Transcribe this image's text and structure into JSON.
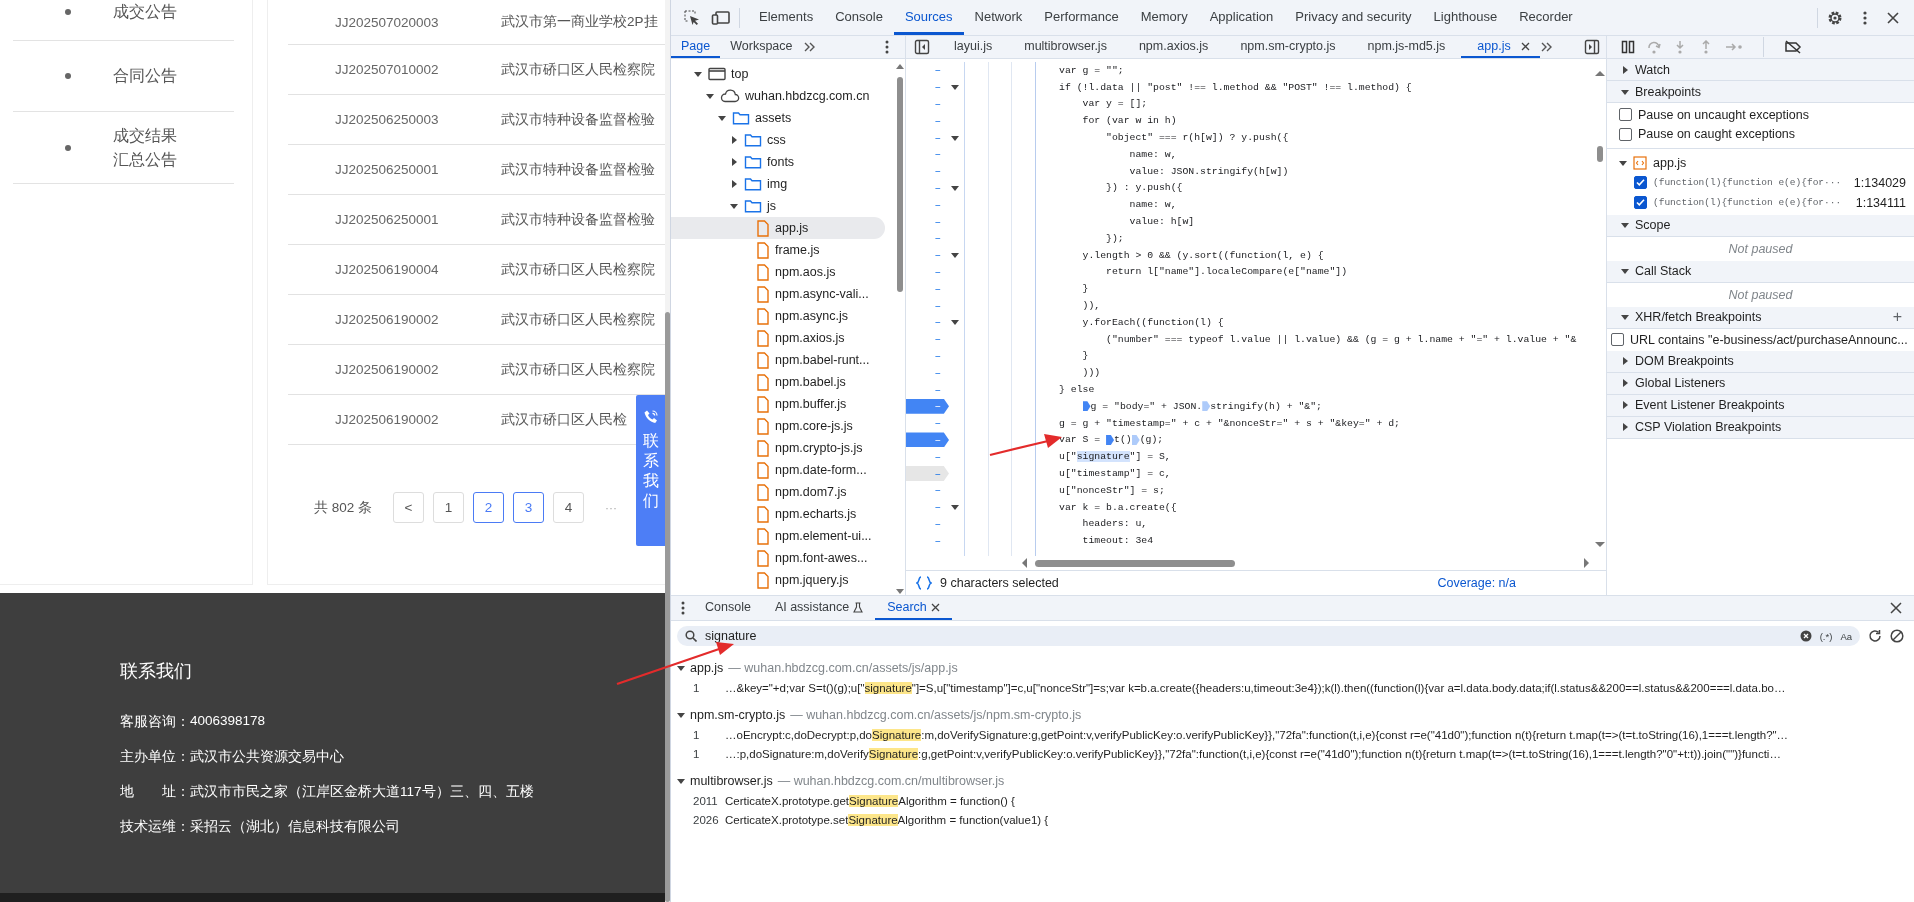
{
  "page": {
    "sidebar": {
      "items": [
        {
          "label": "成交公告"
        },
        {
          "label": "合同公告"
        },
        {
          "label": "成交结果汇总公告"
        }
      ]
    },
    "table": {
      "rows": [
        {
          "code": "JJ202507020003",
          "name": "武汉市第一商业学校2P挂"
        },
        {
          "code": "JJ202507010002",
          "name": "武汉市硚口区人民检察院"
        },
        {
          "code": "JJ202506250003",
          "name": "武汉市特种设备监督检验"
        },
        {
          "code": "JJ202506250001",
          "name": "武汉市特种设备监督检验"
        },
        {
          "code": "JJ202506250001",
          "name": "武汉市特种设备监督检验"
        },
        {
          "code": "JJ202506190004",
          "name": "武汉市硚口区人民检察院"
        },
        {
          "code": "JJ202506190002",
          "name": "武汉市硚口区人民检察院"
        },
        {
          "code": "JJ202506190002",
          "name": "武汉市硚口区人民检察院"
        },
        {
          "code": "JJ202506190002",
          "name": "武汉市硚口区人民检"
        }
      ]
    },
    "pagination": {
      "total": "共 802 条",
      "prev": "<",
      "pages": [
        {
          "label": "1",
          "highlighted": false
        },
        {
          "label": "2",
          "highlighted": true
        },
        {
          "label": "3",
          "highlighted": true
        },
        {
          "label": "4",
          "highlighted": false
        }
      ],
      "ellipsis": "···"
    },
    "contact_tab": {
      "label": "联系我们"
    },
    "footer": {
      "title": "联系我们",
      "lines": [
        {
          "label": "客服咨询：",
          "value": "4006398178"
        },
        {
          "label": "主办单位：",
          "value": "武汉市公共资源交易中心"
        },
        {
          "label": "地　　址：",
          "value": "武汉市市民之家（江岸区金桥大道117号）三、四、五楼"
        },
        {
          "label": "技术运维：",
          "value": "采招云（湖北）信息科技有限公司"
        }
      ]
    }
  },
  "devtools": {
    "panel_tabs": [
      {
        "label": "Elements",
        "selected": false
      },
      {
        "label": "Console",
        "selected": false
      },
      {
        "label": "Sources",
        "selected": true
      },
      {
        "label": "Network",
        "selected": false
      },
      {
        "label": "Performance",
        "selected": false
      },
      {
        "label": "Memory",
        "selected": false
      },
      {
        "label": "Application",
        "selected": false
      },
      {
        "label": "Privacy and security",
        "selected": false
      },
      {
        "label": "Lighthouse",
        "selected": false
      },
      {
        "label": "Recorder",
        "selected": false
      }
    ],
    "navigator": {
      "tabs": [
        {
          "label": "Page",
          "selected": true
        },
        {
          "label": "Workspace",
          "selected": false
        }
      ],
      "tree": [
        {
          "label": "top",
          "kind": "frame",
          "expanded": true,
          "selected": false,
          "children": [
            {
              "label": "wuhan.hbdzcg.com.cn",
              "kind": "domain",
              "expanded": true,
              "selected": false,
              "children": [
                {
                  "label": "assets",
                  "kind": "folder",
                  "expanded": true,
                  "selected": false,
                  "children": [
                    {
                      "label": "css",
                      "kind": "folder",
                      "expanded": false,
                      "selected": false
                    },
                    {
                      "label": "fonts",
                      "kind": "folder",
                      "expanded": false,
                      "selected": false
                    },
                    {
                      "label": "img",
                      "kind": "folder",
                      "expanded": false,
                      "selected": false
                    },
                    {
                      "label": "js",
                      "kind": "folder",
                      "expanded": true,
                      "selected": false,
                      "children": [
                        {
                          "label": "app.js",
                          "kind": "file",
                          "selected": true
                        },
                        {
                          "label": "frame.js",
                          "kind": "file",
                          "selected": false
                        },
                        {
                          "label": "npm.aos.js",
                          "kind": "file",
                          "selected": false
                        },
                        {
                          "label": "npm.async-vali...",
                          "kind": "file",
                          "selected": false
                        },
                        {
                          "label": "npm.async.js",
                          "kind": "file",
                          "selected": false
                        },
                        {
                          "label": "npm.axios.js",
                          "kind": "file",
                          "selected": false
                        },
                        {
                          "label": "npm.babel-runt...",
                          "kind": "file",
                          "selected": false
                        },
                        {
                          "label": "npm.babel.js",
                          "kind": "file",
                          "selected": false
                        },
                        {
                          "label": "npm.buffer.js",
                          "kind": "file",
                          "selected": false
                        },
                        {
                          "label": "npm.core-js.js",
                          "kind": "file",
                          "selected": false
                        },
                        {
                          "label": "npm.crypto-js.js",
                          "kind": "file",
                          "selected": false
                        },
                        {
                          "label": "npm.date-form...",
                          "kind": "file",
                          "selected": false
                        },
                        {
                          "label": "npm.dom7.js",
                          "kind": "file",
                          "selected": false
                        },
                        {
                          "label": "npm.echarts.js",
                          "kind": "file",
                          "selected": false
                        },
                        {
                          "label": "npm.element-ui...",
                          "kind": "file",
                          "selected": false
                        },
                        {
                          "label": "npm.font-awes...",
                          "kind": "file",
                          "selected": false
                        },
                        {
                          "label": "npm.jquery.js",
                          "kind": "file",
                          "selected": false
                        }
                      ]
                    }
                  ]
                }
              ]
            }
          ]
        }
      ]
    },
    "editor": {
      "tabs": [
        {
          "label": "layui.js",
          "selected": false
        },
        {
          "label": "multibrowser.js",
          "selected": false
        },
        {
          "label": "npm.axios.js",
          "selected": false
        },
        {
          "label": "npm.sm-crypto.js",
          "selected": false
        },
        {
          "label": "npm.js-md5.js",
          "selected": false
        },
        {
          "label": "app.js",
          "selected": true
        }
      ],
      "lines": [
        {
          "gutter": "–",
          "fold": false,
          "breakpoint": false,
          "hovered": false,
          "text": "var g = \"\";"
        },
        {
          "gutter": "–",
          "fold": true,
          "breakpoint": false,
          "hovered": false,
          "text": "if (!l.data || \"post\" !== l.method && \"POST\" !== l.method) {"
        },
        {
          "gutter": "–",
          "fold": false,
          "breakpoint": false,
          "hovered": false,
          "text": "    var y = [];"
        },
        {
          "gutter": "–",
          "fold": false,
          "breakpoint": false,
          "hovered": false,
          "text": "    for (var w in h)"
        },
        {
          "gutter": "–",
          "fold": true,
          "breakpoint": false,
          "hovered": false,
          "text": "        \"object\" === r(h[w]) ? y.push({"
        },
        {
          "gutter": "–",
          "fold": false,
          "breakpoint": false,
          "hovered": false,
          "text": "            name: w,"
        },
        {
          "gutter": "–",
          "fold": false,
          "breakpoint": false,
          "hovered": false,
          "text": "            value: JSON.stringify(h[w])"
        },
        {
          "gutter": "–",
          "fold": true,
          "breakpoint": false,
          "hovered": false,
          "text": "        }) : y.push({"
        },
        {
          "gutter": "–",
          "fold": false,
          "breakpoint": false,
          "hovered": false,
          "text": "            name: w,"
        },
        {
          "gutter": "–",
          "fold": false,
          "breakpoint": false,
          "hovered": false,
          "text": "            value: h[w]"
        },
        {
          "gutter": "–",
          "fold": false,
          "breakpoint": false,
          "hovered": false,
          "text": "        });"
        },
        {
          "gutter": "–",
          "fold": true,
          "breakpoint": false,
          "hovered": false,
          "text": "    y.length > 0 && (y.sort((function(l, e) {"
        },
        {
          "gutter": "–",
          "fold": false,
          "breakpoint": false,
          "hovered": false,
          "text": "        return l[\"name\"].localeCompare(e[\"name\"])"
        },
        {
          "gutter": "–",
          "fold": false,
          "breakpoint": false,
          "hovered": false,
          "text": "    }"
        },
        {
          "gutter": "–",
          "fold": false,
          "breakpoint": false,
          "hovered": false,
          "text": "    )),"
        },
        {
          "gutter": "–",
          "fold": true,
          "breakpoint": false,
          "hovered": false,
          "text": "    y.forEach((function(l) {"
        },
        {
          "gutter": "–",
          "fold": false,
          "breakpoint": false,
          "hovered": false,
          "text": "        (\"number\" === typeof l.value || l.value) && (g = g + l.name + \"=\" + l.value + \"&"
        },
        {
          "gutter": "–",
          "fold": false,
          "breakpoint": false,
          "hovered": false,
          "text": "    }"
        },
        {
          "gutter": "–",
          "fold": false,
          "breakpoint": false,
          "hovered": false,
          "text": "    )))"
        },
        {
          "gutter": "–",
          "fold": false,
          "breakpoint": false,
          "hovered": false,
          "text": "} else"
        },
        {
          "gutter": "–",
          "fold": false,
          "breakpoint": true,
          "hovered": false,
          "segments": [
            {
              "kind": "indent"
            },
            {
              "kind": "bp-active"
            },
            {
              "kind": "code",
              "text": "g = \"body=\" + JSON."
            },
            {
              "kind": "bp-inactive"
            },
            {
              "kind": "code",
              "text": "stringify(h) + \"&\";"
            }
          ]
        },
        {
          "gutter": "–",
          "fold": false,
          "breakpoint": false,
          "hovered": false,
          "text": "g = g + \"timestamp=\" + c + \"&nonceStr=\" + s + \"&key=\" + d;"
        },
        {
          "gutter": "–",
          "fold": false,
          "breakpoint": true,
          "hovered": false,
          "segments": [
            {
              "kind": "code",
              "text": "var S = "
            },
            {
              "kind": "bp-active"
            },
            {
              "kind": "code",
              "text": "t()"
            },
            {
              "kind": "bp-inactive"
            },
            {
              "kind": "code",
              "text": "(g);"
            }
          ]
        },
        {
          "gutter": "–",
          "fold": false,
          "breakpoint": false,
          "hovered": false,
          "segments": [
            {
              "kind": "code",
              "text": "u[\""
            },
            {
              "kind": "selected",
              "text": "signature"
            },
            {
              "kind": "code",
              "text": "\"] = S,"
            }
          ]
        },
        {
          "gutter": "–",
          "fold": false,
          "breakpoint": false,
          "hovered": true,
          "text": "u[\"timestamp\"] = c,"
        },
        {
          "gutter": "–",
          "fold": false,
          "breakpoint": false,
          "hovered": false,
          "text": "u[\"nonceStr\"] = s;"
        },
        {
          "gutter": "–",
          "fold": true,
          "breakpoint": false,
          "hovered": false,
          "text": "var k = b.a.create({"
        },
        {
          "gutter": "–",
          "fold": false,
          "breakpoint": false,
          "hovered": false,
          "text": "    headers: u,"
        },
        {
          "gutter": "–",
          "fold": false,
          "breakpoint": false,
          "hovered": false,
          "text": "    timeout: 3e4"
        }
      ],
      "status": "9 characters selected",
      "coverage": "Coverage: n/a"
    },
    "debugger": {
      "sections": [
        {
          "title": "Watch",
          "expanded": false,
          "kind": "plain"
        },
        {
          "title": "Breakpoints",
          "expanded": true,
          "kind": "breakpoints",
          "options": [
            {
              "label": "Pause on uncaught exceptions",
              "checked": false
            },
            {
              "label": "Pause on caught exceptions",
              "checked": false
            }
          ],
          "files": [
            {
              "name": "app.js",
              "expanded": true,
              "breakpoints": [
                {
                  "code": "(function(l){function e(e){for···",
                  "location": "1:134029",
                  "checked": true
                },
                {
                  "code": "(function(l){function e(e){for···",
                  "location": "1:134111",
                  "checked": true
                }
              ]
            }
          ]
        },
        {
          "title": "Scope",
          "expanded": true,
          "kind": "message",
          "message": "Not paused"
        },
        {
          "title": "Call Stack",
          "expanded": true,
          "kind": "message",
          "message": "Not paused"
        },
        {
          "title": "XHR/fetch Breakpoints",
          "expanded": true,
          "kind": "xhr",
          "add": "+",
          "items": [
            {
              "label": "URL contains \"e-business/act/purchaseAnnounc...",
              "checked": false
            }
          ]
        },
        {
          "title": "DOM Breakpoints",
          "expanded": false,
          "kind": "plain"
        },
        {
          "title": "Global Listeners",
          "expanded": false,
          "kind": "plain"
        },
        {
          "title": "Event Listener Breakpoints",
          "expanded": false,
          "kind": "plain"
        },
        {
          "title": "CSP Violation Breakpoints",
          "expanded": false,
          "kind": "plain"
        }
      ]
    },
    "drawer": {
      "tabs": [
        {
          "label": "Console",
          "selected": false,
          "kind": "plain"
        },
        {
          "label": "AI assistance",
          "selected": false,
          "kind": "experiment"
        },
        {
          "label": "Search",
          "selected": true,
          "kind": "closable"
        }
      ],
      "search": {
        "value": "signature",
        "regex": "(.*)",
        "match_case": "Aa"
      },
      "results": [
        {
          "file": "app.js",
          "path": "— wuhan.hbdzcg.com.cn/assets/js/app.js",
          "expanded": true,
          "matches": [
            {
              "line": "1",
              "before": "…&key=\"+d;var S=t()(g);u[\"",
              "match": "signature",
              "after": "\"]=S,u[\"timestamp\"]=c,u[\"nonceStr\"]=s;var k=b.a.create({headers:u,timeout:3e4});k(l).then((function(l){var a=l.data.body.data;if(l.status&&200==l.status&&200===l.data.bo…"
            }
          ]
        },
        {
          "file": "npm.sm-crypto.js",
          "path": "— wuhan.hbdzcg.com.cn/assets/js/npm.sm-crypto.js",
          "expanded": true,
          "matches": [
            {
              "line": "1",
              "before": "…oEncrypt:c,doDecrypt:p,do",
              "match": "Signature",
              "after": ":m,doVerifySignature:g,getPoint:v,verifyPublicKey:o.verifyPublicKey}},\"72fa\":function(t,i,e){const r=e(\"41d0\");function n(t){return t.map(t=>(t=t.toString(16),1===t.length?\"…"
            },
            {
              "line": "1",
              "before": "…:p,doSignature:m,doVerify",
              "match": "Signature",
              "after": ":g,getPoint:v,verifyPublicKey:o.verifyPublicKey}},\"72fa\":function(t,i,e){const r=e(\"41d0\");function n(t){return t.map(t=>(t=t.toString(16),1===t.length?\"0\"+t:t)).join(\"\")}functi…"
            }
          ]
        },
        {
          "file": "multibrowser.js",
          "path": "— wuhan.hbdzcg.com.cn/multibrowser.js",
          "expanded": true,
          "matches": [
            {
              "line": "2011",
              "before": "CerticateX.prototype.get",
              "match": "Signature",
              "after": "Algorithm = function() {"
            },
            {
              "line": "2026",
              "before": "CerticateX.prototype.set",
              "match": "Signature",
              "after": "Algorithm = function(value1) {"
            }
          ]
        }
      ]
    }
  }
}
